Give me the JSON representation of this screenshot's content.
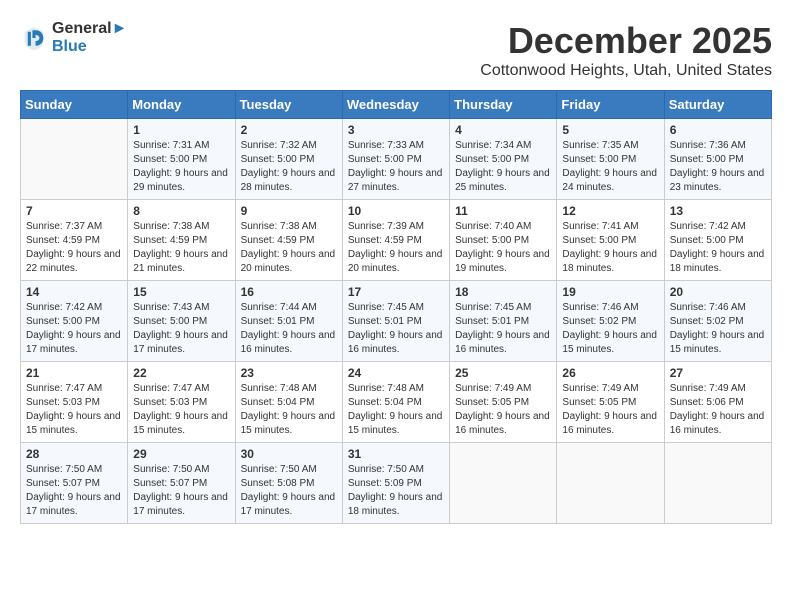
{
  "header": {
    "logo_line1": "General",
    "logo_line2": "Blue",
    "month": "December 2025",
    "location": "Cottonwood Heights, Utah, United States"
  },
  "days_of_week": [
    "Sunday",
    "Monday",
    "Tuesday",
    "Wednesday",
    "Thursday",
    "Friday",
    "Saturday"
  ],
  "weeks": [
    [
      {
        "day": "",
        "sunrise": "",
        "sunset": "",
        "daylight": ""
      },
      {
        "day": "1",
        "sunrise": "7:31 AM",
        "sunset": "5:00 PM",
        "daylight": "9 hours and 29 minutes."
      },
      {
        "day": "2",
        "sunrise": "7:32 AM",
        "sunset": "5:00 PM",
        "daylight": "9 hours and 28 minutes."
      },
      {
        "day": "3",
        "sunrise": "7:33 AM",
        "sunset": "5:00 PM",
        "daylight": "9 hours and 27 minutes."
      },
      {
        "day": "4",
        "sunrise": "7:34 AM",
        "sunset": "5:00 PM",
        "daylight": "9 hours and 25 minutes."
      },
      {
        "day": "5",
        "sunrise": "7:35 AM",
        "sunset": "5:00 PM",
        "daylight": "9 hours and 24 minutes."
      },
      {
        "day": "6",
        "sunrise": "7:36 AM",
        "sunset": "5:00 PM",
        "daylight": "9 hours and 23 minutes."
      }
    ],
    [
      {
        "day": "7",
        "sunrise": "7:37 AM",
        "sunset": "4:59 PM",
        "daylight": "9 hours and 22 minutes."
      },
      {
        "day": "8",
        "sunrise": "7:38 AM",
        "sunset": "4:59 PM",
        "daylight": "9 hours and 21 minutes."
      },
      {
        "day": "9",
        "sunrise": "7:38 AM",
        "sunset": "4:59 PM",
        "daylight": "9 hours and 20 minutes."
      },
      {
        "day": "10",
        "sunrise": "7:39 AM",
        "sunset": "4:59 PM",
        "daylight": "9 hours and 20 minutes."
      },
      {
        "day": "11",
        "sunrise": "7:40 AM",
        "sunset": "5:00 PM",
        "daylight": "9 hours and 19 minutes."
      },
      {
        "day": "12",
        "sunrise": "7:41 AM",
        "sunset": "5:00 PM",
        "daylight": "9 hours and 18 minutes."
      },
      {
        "day": "13",
        "sunrise": "7:42 AM",
        "sunset": "5:00 PM",
        "daylight": "9 hours and 18 minutes."
      }
    ],
    [
      {
        "day": "14",
        "sunrise": "7:42 AM",
        "sunset": "5:00 PM",
        "daylight": "9 hours and 17 minutes."
      },
      {
        "day": "15",
        "sunrise": "7:43 AM",
        "sunset": "5:00 PM",
        "daylight": "9 hours and 17 minutes."
      },
      {
        "day": "16",
        "sunrise": "7:44 AM",
        "sunset": "5:01 PM",
        "daylight": "9 hours and 16 minutes."
      },
      {
        "day": "17",
        "sunrise": "7:45 AM",
        "sunset": "5:01 PM",
        "daylight": "9 hours and 16 minutes."
      },
      {
        "day": "18",
        "sunrise": "7:45 AM",
        "sunset": "5:01 PM",
        "daylight": "9 hours and 16 minutes."
      },
      {
        "day": "19",
        "sunrise": "7:46 AM",
        "sunset": "5:02 PM",
        "daylight": "9 hours and 15 minutes."
      },
      {
        "day": "20",
        "sunrise": "7:46 AM",
        "sunset": "5:02 PM",
        "daylight": "9 hours and 15 minutes."
      }
    ],
    [
      {
        "day": "21",
        "sunrise": "7:47 AM",
        "sunset": "5:03 PM",
        "daylight": "9 hours and 15 minutes."
      },
      {
        "day": "22",
        "sunrise": "7:47 AM",
        "sunset": "5:03 PM",
        "daylight": "9 hours and 15 minutes."
      },
      {
        "day": "23",
        "sunrise": "7:48 AM",
        "sunset": "5:04 PM",
        "daylight": "9 hours and 15 minutes."
      },
      {
        "day": "24",
        "sunrise": "7:48 AM",
        "sunset": "5:04 PM",
        "daylight": "9 hours and 15 minutes."
      },
      {
        "day": "25",
        "sunrise": "7:49 AM",
        "sunset": "5:05 PM",
        "daylight": "9 hours and 16 minutes."
      },
      {
        "day": "26",
        "sunrise": "7:49 AM",
        "sunset": "5:05 PM",
        "daylight": "9 hours and 16 minutes."
      },
      {
        "day": "27",
        "sunrise": "7:49 AM",
        "sunset": "5:06 PM",
        "daylight": "9 hours and 16 minutes."
      }
    ],
    [
      {
        "day": "28",
        "sunrise": "7:50 AM",
        "sunset": "5:07 PM",
        "daylight": "9 hours and 17 minutes."
      },
      {
        "day": "29",
        "sunrise": "7:50 AM",
        "sunset": "5:07 PM",
        "daylight": "9 hours and 17 minutes."
      },
      {
        "day": "30",
        "sunrise": "7:50 AM",
        "sunset": "5:08 PM",
        "daylight": "9 hours and 17 minutes."
      },
      {
        "day": "31",
        "sunrise": "7:50 AM",
        "sunset": "5:09 PM",
        "daylight": "9 hours and 18 minutes."
      },
      {
        "day": "",
        "sunrise": "",
        "sunset": "",
        "daylight": ""
      },
      {
        "day": "",
        "sunrise": "",
        "sunset": "",
        "daylight": ""
      },
      {
        "day": "",
        "sunrise": "",
        "sunset": "",
        "daylight": ""
      }
    ]
  ],
  "labels": {
    "sunrise_prefix": "Sunrise: ",
    "sunset_prefix": "Sunset: ",
    "daylight_prefix": "Daylight: "
  }
}
